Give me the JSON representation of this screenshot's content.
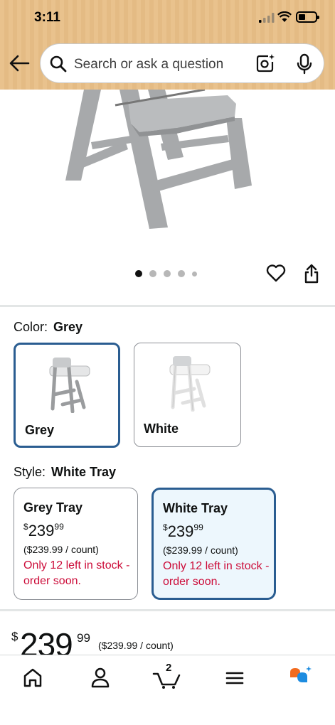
{
  "status_bar": {
    "time": "3:11"
  },
  "search": {
    "placeholder": "Search or ask a question"
  },
  "gallery": {
    "dot_count": 5,
    "active_index": 0
  },
  "color": {
    "label": "Color:",
    "selected": "Grey",
    "options": [
      "Grey",
      "White"
    ]
  },
  "style": {
    "label": "Style:",
    "selected": "White Tray",
    "options": [
      {
        "name": "Grey Tray",
        "currency": "$",
        "whole": "239",
        "fraction": "99",
        "unit_price": "($239.99 / count)",
        "stock": "Only 12 left in stock - order soon."
      },
      {
        "name": "White Tray",
        "currency": "$",
        "whole": "239",
        "fraction": "99",
        "unit_price": "($239.99 / count)",
        "stock": "Only 12 left in stock - order soon."
      }
    ]
  },
  "price": {
    "currency": "$",
    "whole": "239",
    "fraction": "99",
    "unit_price": "($239.99 / count)"
  },
  "bottom_nav": {
    "cart_count": "2",
    "items": [
      "home-icon",
      "account-icon",
      "cart-icon",
      "menu-icon",
      "rufus-icon"
    ]
  },
  "colors": {
    "selected_border": "#2a5d91",
    "stock_red": "#cc0c39",
    "header": "#e9c28d"
  }
}
